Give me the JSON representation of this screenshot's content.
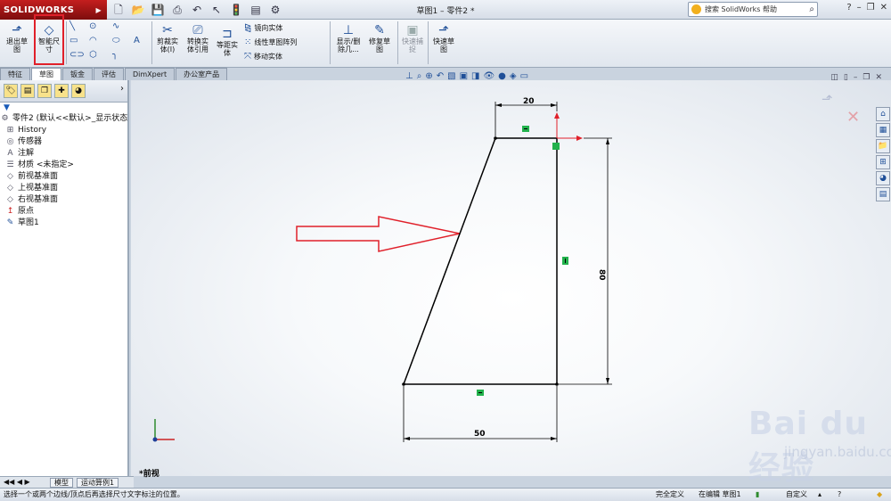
{
  "app": {
    "logo": "SOLIDWORKS",
    "doc_title": "草图1 – 零件2 *"
  },
  "search": {
    "placeholder": "搜索 SolidWorks 帮助"
  },
  "ribbon": {
    "exit_sketch": "退出草\n图",
    "smart_dim": "智能尺\n寸",
    "trim": "剪裁实\n体(I)",
    "convert": "转换实\n体引用",
    "offset": "等距实\n体",
    "mirror": "镜向实体",
    "linear_pattern": "线性草图阵列",
    "move": "移动实体",
    "display_delete": "显示/删\n除几...",
    "repair": "修复草\n图",
    "quick_snap": "快速捕\n捉",
    "rapid_sketch": "快速草\n图"
  },
  "tabs": [
    "特征",
    "草图",
    "钣金",
    "评估",
    "DimXpert",
    "办公室产品"
  ],
  "tree": {
    "root": "零件2 (默认<<默认>_显示状态",
    "items": [
      "History",
      "传感器",
      "注解",
      "材质 <未指定>",
      "前视基准面",
      "上视基准面",
      "右视基准面",
      "原点",
      "草图1"
    ]
  },
  "dimensions": {
    "top": "20",
    "right": "80",
    "bottom": "50"
  },
  "view_label": "*前视",
  "bottom_tabs": [
    "模型",
    "运动算例1"
  ],
  "status": {
    "hint": "选择一个或两个边线/顶点后再选择尺寸文字标注的位置。",
    "defined": "完全定义",
    "editing": "在编辑 草图1",
    "custom": "自定义"
  },
  "watermark": {
    "brand": "Bai  du经验",
    "url": "jingyan.baidu.com"
  },
  "colors": {
    "accent_red": "#e0202a",
    "sketch_green": "#22b14c"
  }
}
